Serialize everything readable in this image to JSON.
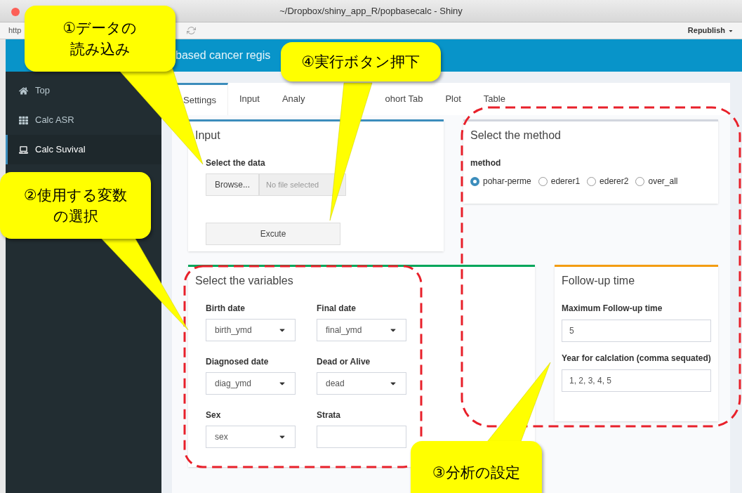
{
  "window": {
    "title": "~/Dropbox/shiny_app_R/popbasecalc - Shiny"
  },
  "toolbar": {
    "address": "http",
    "republish": "Republish"
  },
  "header": {
    "title": "based cancer regis"
  },
  "sidebar": {
    "items": [
      {
        "label": "Top",
        "selected": false
      },
      {
        "label": "Calc ASR",
        "selected": false
      },
      {
        "label": "Calc Suvival",
        "selected": true
      }
    ]
  },
  "tabs": [
    {
      "label": "Settings",
      "selected": true
    },
    {
      "label": "Input",
      "selected": false
    },
    {
      "label": "Analy",
      "selected": false
    },
    {
      "label": "ohort Tab",
      "selected": false
    },
    {
      "label": "Plot",
      "selected": false
    },
    {
      "label": "Table",
      "selected": false
    }
  ],
  "input_panel": {
    "title": "Input",
    "field_label": "Select the data",
    "browse": "Browse...",
    "placeholder": "No file selected",
    "execute": "Excute"
  },
  "method_panel": {
    "title": "Select the method",
    "label": "method",
    "options": [
      {
        "label": "pohar-perme",
        "selected": true
      },
      {
        "label": "ederer1",
        "selected": false
      },
      {
        "label": "ederer2",
        "selected": false
      },
      {
        "label": "over_all",
        "selected": false
      }
    ]
  },
  "variables_panel": {
    "title": "Select the variables",
    "fields": [
      {
        "label": "Birth date",
        "kind": "select",
        "value": "birth_ymd"
      },
      {
        "label": "Final date",
        "kind": "select",
        "value": "final_ymd"
      },
      {
        "label": "Diagnosed date",
        "kind": "select",
        "value": "diag_ymd"
      },
      {
        "label": "Dead or Alive",
        "kind": "select",
        "value": "dead"
      },
      {
        "label": "Sex",
        "kind": "select",
        "value": "sex"
      },
      {
        "label": "Strata",
        "kind": "text"
      }
    ]
  },
  "followup_panel": {
    "title": "Follow-up time",
    "fields": [
      {
        "label": "Maximum Follow-up time",
        "value": "5"
      },
      {
        "label": "Year for calclation (comma sequated)",
        "value": "1, 2, 3, 4, 5"
      }
    ]
  },
  "callouts": [
    {
      "lines": [
        "①データの",
        "読み込み"
      ]
    },
    {
      "lines": [
        "②使用する変数",
        "の選択"
      ]
    },
    {
      "lines": [
        "③分析の設定"
      ]
    },
    {
      "lines": [
        "④実行ボタン押下"
      ]
    }
  ]
}
